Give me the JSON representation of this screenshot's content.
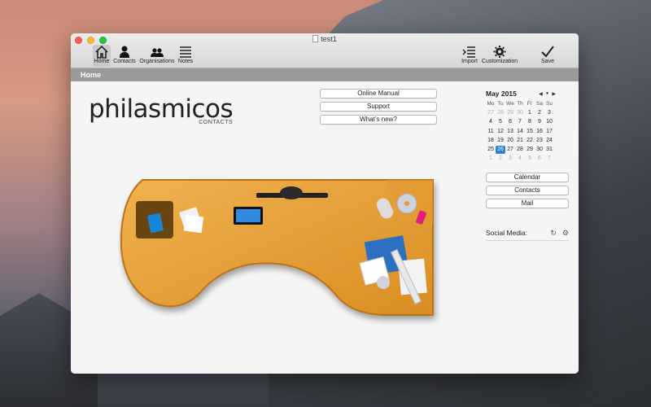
{
  "window": {
    "title": "test1"
  },
  "toolbar": {
    "home": "Home",
    "contacts": "Contacts",
    "organisations": "Organisations",
    "notes": "Notes",
    "import": "Import",
    "customization": "Customization",
    "save": "Save"
  },
  "tab": {
    "label": "Home"
  },
  "logo": {
    "main": "philasmicos",
    "sub": "CONTACTS"
  },
  "links": {
    "online_manual": "Online Manual",
    "support": "Support",
    "whats_new": "What’s new?"
  },
  "calendar": {
    "title": "May 2015",
    "weekdays": [
      "Mo",
      "Tu",
      "We",
      "Th",
      "Fr",
      "Sa",
      "Su"
    ],
    "weeks": [
      [
        "27",
        "28",
        "29",
        "30",
        "1",
        "2",
        "3"
      ],
      [
        "4",
        "5",
        "6",
        "7",
        "8",
        "9",
        "10"
      ],
      [
        "11",
        "12",
        "13",
        "14",
        "15",
        "16",
        "17"
      ],
      [
        "18",
        "19",
        "20",
        "21",
        "22",
        "23",
        "24"
      ],
      [
        "25",
        "26",
        "27",
        "28",
        "29",
        "30",
        "31"
      ],
      [
        "1",
        "2",
        "3",
        "4",
        "5",
        "6",
        "7"
      ]
    ],
    "selected": "26",
    "accent_color": "#2a7fe0"
  },
  "nav_buttons": {
    "calendar": "Calendar",
    "contacts": "Contacts",
    "mail": "Mail"
  },
  "social": {
    "label": "Social Media:"
  },
  "icons": {
    "home": "house-icon",
    "contacts": "person-icon",
    "organisations": "people-icon",
    "notes": "list-icon",
    "import": "import-icon",
    "customization": "gear-icon",
    "save": "checkmark-icon",
    "refresh": "refresh-icon",
    "settings": "gear-icon"
  }
}
